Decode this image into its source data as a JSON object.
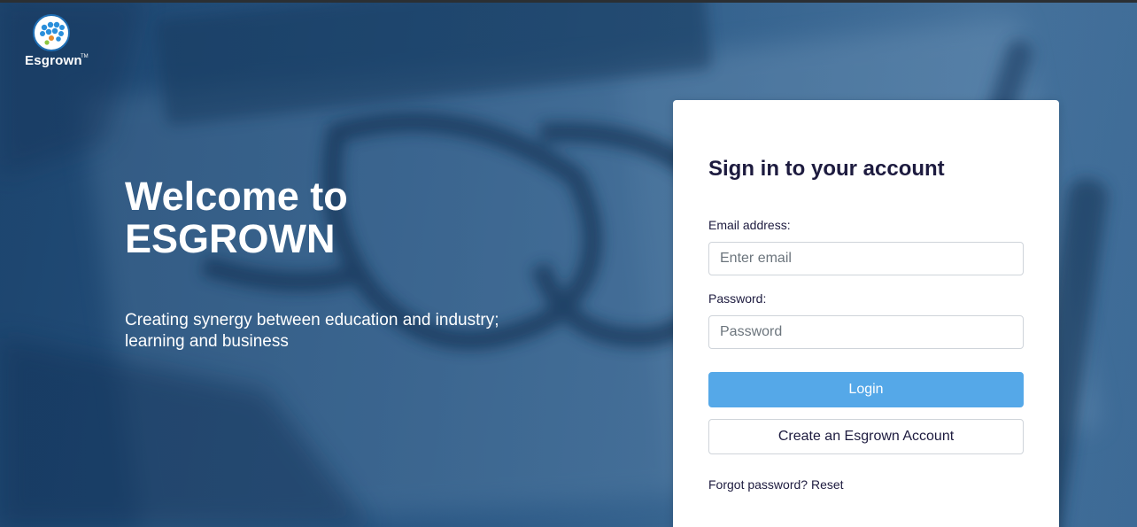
{
  "brand": {
    "name": "Esgrown",
    "trademark": "TM"
  },
  "hero": {
    "title_line1": "Welcome to",
    "title_line2": "ESGROWN",
    "subtitle": "Creating synergy between education and industry; learning and business"
  },
  "login_card": {
    "title": "Sign in to your account",
    "email_label": "Email address:",
    "email_placeholder": "Enter email",
    "email_value": "",
    "password_label": "Password:",
    "password_placeholder": "Password",
    "password_value": "",
    "login_button": "Login",
    "create_account_button": "Create an Esgrown Account",
    "forgot_text": "Forgot password?",
    "reset_link": "Reset"
  },
  "colors": {
    "background": "#2c5a85",
    "login_button": "#55a8e8",
    "card_text": "#1d1b3f",
    "card_background": "#ffffff"
  },
  "icons": {
    "logo": "esgrown-logo-icon"
  }
}
